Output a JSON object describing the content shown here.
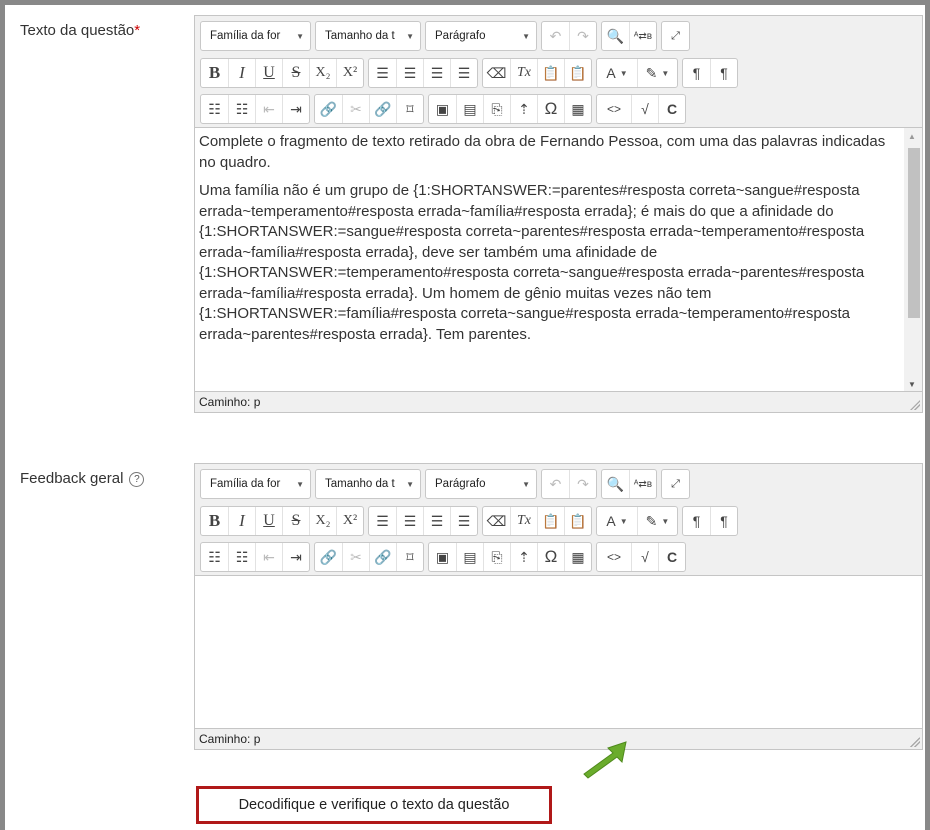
{
  "question_text": {
    "label": "Texto da questão",
    "required_marker": "*",
    "font_family": "Família da for",
    "font_size": "Tamanho da t",
    "paragraph_format": "Parágrafo",
    "content_paragraphs": [
      "Complete o fragmento de texto retirado da obra de Fernando Pessoa, com uma das palavras indicadas no quadro.",
      "Uma família não é um grupo de {1:SHORTANSWER:=parentes#resposta correta~sangue#resposta errada~temperamento#resposta errada~família#resposta errada}; é mais do que a afinidade do {1:SHORTANSWER:=sangue#resposta correta~parentes#resposta errada~temperamento#resposta errada~família#resposta errada}, deve ser também uma afinidade de {1:SHORTANSWER:=temperamento#resposta correta~sangue#resposta errada~parentes#resposta errada~família#resposta errada}. Um homem de gênio muitas vezes não tem {1:SHORTANSWER:=família#resposta correta~sangue#resposta errada~temperamento#resposta errada~parentes#resposta errada}. Tem parentes."
    ],
    "path": "Caminho: p"
  },
  "general_feedback": {
    "label": "Feedback geral",
    "help_icon": "?",
    "font_family": "Família da for",
    "font_size": "Tamanho da t",
    "paragraph_format": "Parágrafo",
    "path": "Caminho: p"
  },
  "decode_button": "Decodifique e verifique o texto da questão",
  "toolbar_glyphs": {
    "bold": "B",
    "italic": "I",
    "underline": "U",
    "strike": "S",
    "sub": "X₂",
    "sup": "X²",
    "omega": "Ω",
    "code": "<>",
    "c": "C"
  },
  "colors": {
    "highlight_border": "#b01818",
    "arrow": "#6aac2c"
  }
}
